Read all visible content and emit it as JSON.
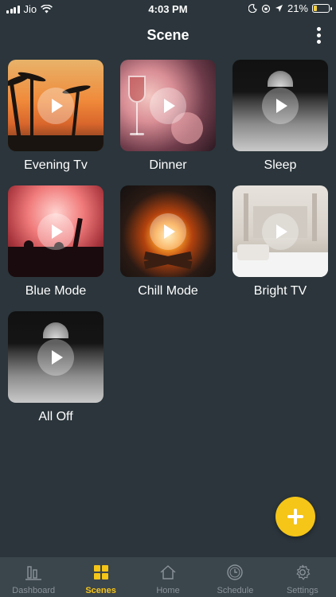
{
  "status_bar": {
    "carrier": "Jio",
    "time": "4:03 PM",
    "battery": "21%",
    "battery_level": 0.21
  },
  "header": {
    "title": "Scene",
    "more_icon": "more-vertical-icon"
  },
  "scenes": [
    {
      "label": "Evening Tv",
      "art": "evening"
    },
    {
      "label": "Dinner",
      "art": "dinner"
    },
    {
      "label": "Sleep",
      "art": "sleep"
    },
    {
      "label": "Blue Mode",
      "art": "blue"
    },
    {
      "label": "Chill Mode",
      "art": "chill"
    },
    {
      "label": "Bright TV",
      "art": "bright"
    },
    {
      "label": "All Off",
      "art": "sleep"
    }
  ],
  "fab": {
    "icon": "plus-icon"
  },
  "bottom_nav": {
    "items": [
      {
        "label": "Dashboard",
        "icon": "dashboard-icon"
      },
      {
        "label": "Scenes",
        "icon": "scenes-icon",
        "active": true
      },
      {
        "label": "Home",
        "icon": "home-icon"
      },
      {
        "label": "Schedule",
        "icon": "clock-icon"
      },
      {
        "label": "Settings",
        "icon": "gear-icon"
      }
    ]
  },
  "colors": {
    "background": "#2b353b",
    "nav_background": "#3b454c",
    "accent": "#f5c518",
    "inactive": "#8a9399"
  }
}
